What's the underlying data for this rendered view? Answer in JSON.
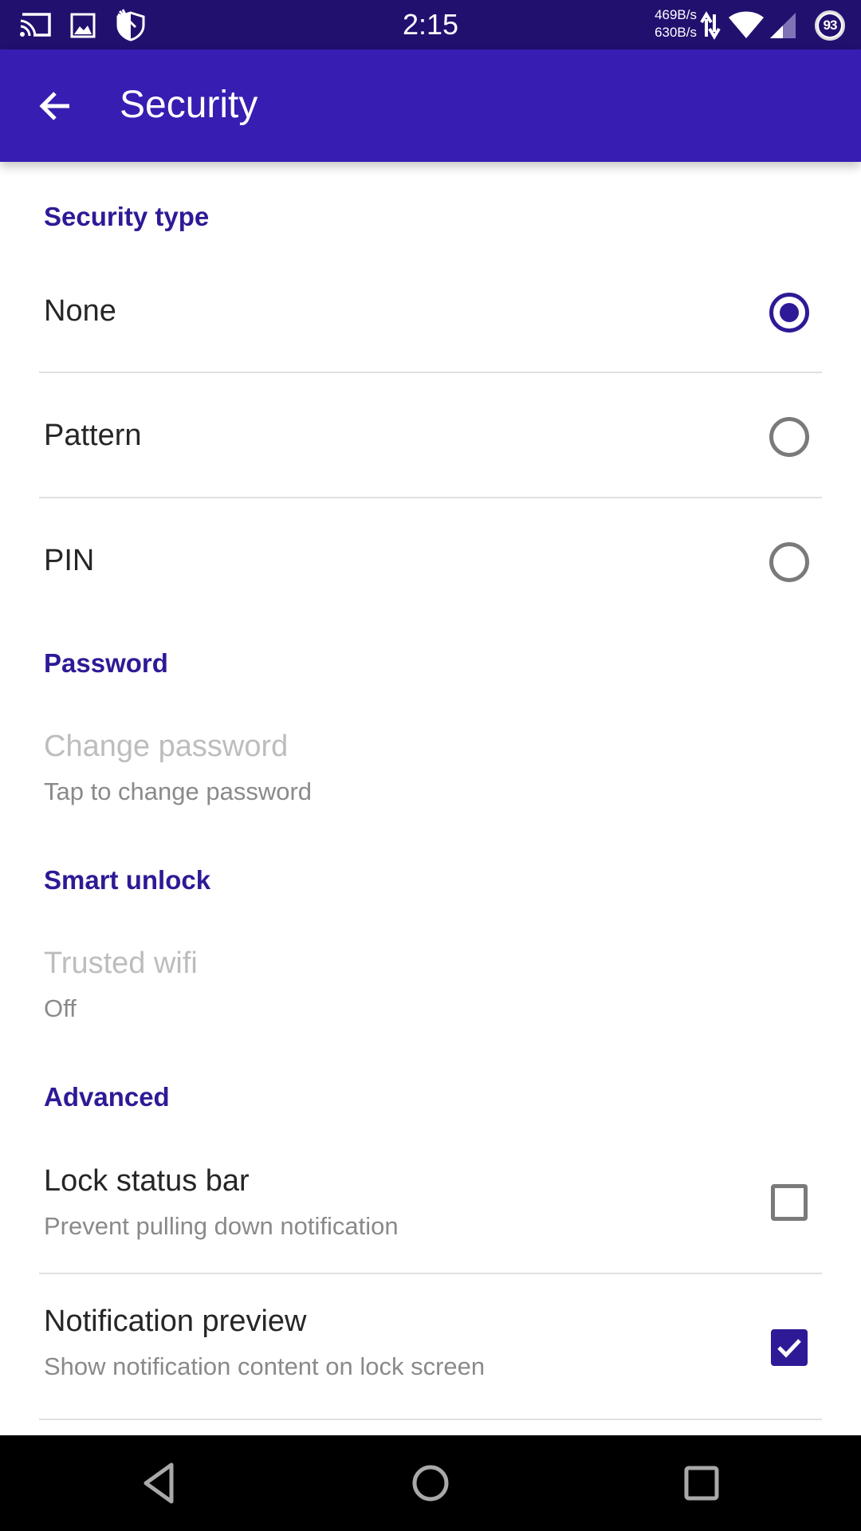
{
  "status_bar": {
    "time": "2:15",
    "upload_speed": "469B/s",
    "download_speed": "630B/s",
    "battery": "93",
    "icons": [
      "cast-icon",
      "image-icon",
      "shield-icon",
      "data-transfer-icon",
      "wifi-icon",
      "cellular-signal-icon",
      "battery-icon"
    ]
  },
  "app_bar": {
    "title": "Security",
    "back_icon": "arrow-back-icon"
  },
  "colors": {
    "accent": "#2e1a96",
    "app_bar": "#371db1",
    "status_bar": "#22106f"
  },
  "sections": {
    "security_type": {
      "header": "Security type",
      "options": [
        {
          "label": "None",
          "selected": true
        },
        {
          "label": "Pattern",
          "selected": false
        },
        {
          "label": "PIN",
          "selected": false
        }
      ]
    },
    "password": {
      "header": "Password",
      "items": [
        {
          "title": "Change password",
          "subtitle": "Tap to change password",
          "enabled": false
        }
      ]
    },
    "smart_unlock": {
      "header": "Smart unlock",
      "items": [
        {
          "title": "Trusted wifi",
          "subtitle": "Off",
          "enabled": false
        }
      ]
    },
    "advanced": {
      "header": "Advanced",
      "items": [
        {
          "title": "Lock status bar",
          "subtitle": "Prevent pulling down notification",
          "checked": false
        },
        {
          "title": "Notification preview",
          "subtitle": "Show notification content on lock screen",
          "checked": true
        }
      ]
    }
  },
  "nav_bar": {
    "buttons": [
      "back-nav-icon",
      "home-nav-icon",
      "recents-nav-icon"
    ]
  }
}
